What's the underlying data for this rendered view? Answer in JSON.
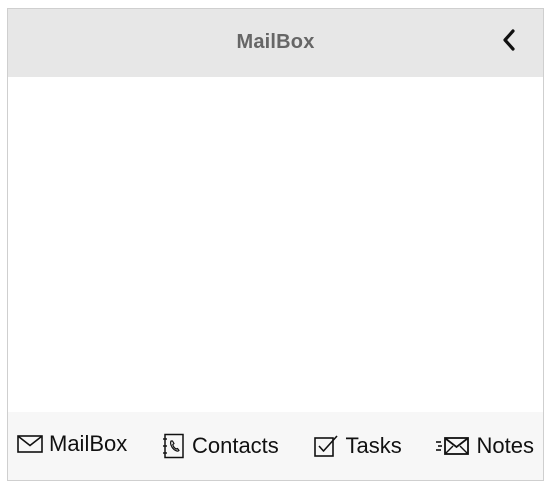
{
  "header": {
    "title": "MailBox",
    "back_icon": "chevron-left-icon"
  },
  "tabbar": {
    "tabs": [
      {
        "label": "MailBox",
        "icon": "envelope-icon",
        "selected": true
      },
      {
        "label": "Contacts",
        "icon": "contacts-book-icon",
        "selected": false
      },
      {
        "label": "Tasks",
        "icon": "checkbox-icon",
        "selected": false
      },
      {
        "label": "Notes",
        "icon": "fast-mail-icon",
        "selected": false
      }
    ]
  },
  "colors": {
    "header_bg": "#e7e7e7",
    "title_text": "#666666",
    "tabbar_bg": "#f7f7f7",
    "frame_border": "#cfcfcf"
  }
}
